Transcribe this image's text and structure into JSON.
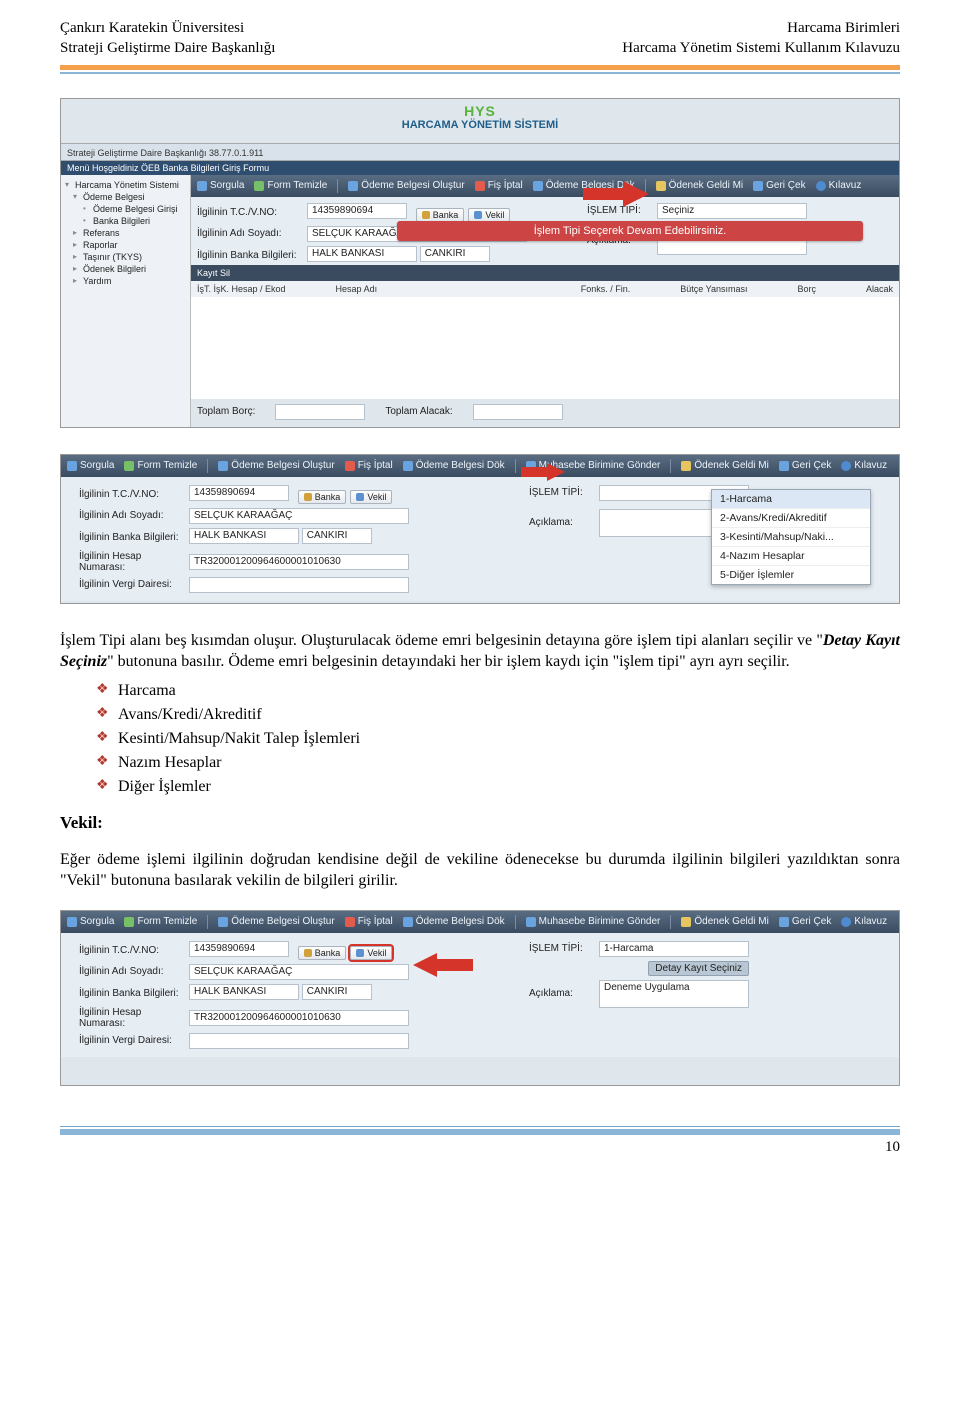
{
  "header": {
    "left_line1": "Çankırı Karatekin Üniversitesi",
    "left_line2": "Strateji Geliştirme Daire Başkanlığı",
    "right_line1": "Harcama Birimleri",
    "right_line2": "Harcama Yönetim Sistemi Kullanım Kılavuzu"
  },
  "shot_common": {
    "app_logo_tag": "HYS",
    "app_logo_sub": "HARCAMA YÖNETİM SİSTEMİ",
    "toolbar": {
      "sorgula": "Sorgula",
      "form_temizle": "Form Temizle",
      "odeme_olustur": "Ödeme Belgesi Oluştur",
      "fis_iptal": "Fiş İptal",
      "odeme_dok": "Ödeme Belgesi Dök",
      "muhasebe_gonder": "Muhasebe Birimine Gönder",
      "odenek_geldi": "Ödenek Geldi Mi",
      "geri_cek": "Geri Çek",
      "kilavuz": "Kılavuz"
    },
    "labels": {
      "tcvno": "İlgilinin T.C./V.NO:",
      "adsoyad": "İlgilinin Adı Soyadı:",
      "banka": "İlgilinin Banka Bilgileri:",
      "hesap": "İlgilinin Hesap Numarası:",
      "vergi": "İlgilinin Vergi Dairesi:",
      "islemtipi": "İŞLEM TİPİ:",
      "aciklama": "Açıklama:"
    },
    "buttons": {
      "banka": "Banka",
      "vekil": "Vekil"
    },
    "values": {
      "tcvno": "14359890694",
      "adsoyad": "SELÇUK KARAAĞAÇ",
      "banka": "HALK BANKASI",
      "banka_sube": "CANKIRI",
      "hesap": "TR320001200964600001010630",
      "vergi": ""
    }
  },
  "shot1": {
    "crumb": "Strateji Geliştirme Daire Başkanlığı 38.77.0.1.911",
    "menu_row": "Menü   Hoşgeldiniz   ÖEB   Banka Bilgileri Giriş Formu",
    "sidebar": {
      "root": "Harcama Yönetim Sistemi",
      "n1": "Ödeme Belgesi",
      "n1a": "Ödeme Belgesi Girişi",
      "n1b": "Banka Bilgileri",
      "n2": "Referans",
      "n3": "Raporlar",
      "n4": "Taşınır (TKYS)",
      "n5": "Ödenek Bilgileri",
      "n6": "Yardım"
    },
    "islemtipi_placeholder": "Seçiniz",
    "banner": "İşlem Tipi Seçerek Devam Edebilirsiniz.",
    "grid_header": "Kayıt Sil",
    "grid_cols": {
      "c1": "İşT. İşK. Hesap / Ekod",
      "c2": "Hesap Adı",
      "c3": "Fonks. / Fin.",
      "c4": "Bütçe Yansıması",
      "c5": "Borç",
      "c6": "Alacak"
    },
    "totals": {
      "borc": "Toplam Borç:",
      "alacak": "Toplam Alacak:"
    }
  },
  "shot2": {
    "dropdown": {
      "o1": "1-Harcama",
      "o2": "2-Avans/Kredi/Akreditif",
      "o3": "3-Kesinti/Mahsup/Naki...",
      "o4": "4-Nazım Hesaplar",
      "o5": "5-Diğer İşlemler"
    }
  },
  "shot3": {
    "islemtipi_value": "1-Harcama",
    "detay_badge": "Detay Kayıt Seçiniz",
    "aciklama_value": "Deneme Uygulama"
  },
  "body": {
    "p1a": "İşlem Tipi alanı beş kısımdan oluşur. Oluşturulacak ödeme emri belgesinin detayına göre işlem tipi alanları seçilir ve \"",
    "p1b": "Detay Kayıt Seçiniz",
    "p1c": "\" butonuna basılır. Ödeme emri belgesinin detayındaki her bir işlem kaydı için \"işlem tipi\" ayrı ayrı seçilir.",
    "li1": "Harcama",
    "li2": "Avans/Kredi/Akreditif",
    "li3": "Kesinti/Mahsup/Nakit Talep İşlemleri",
    "li4": "Nazım Hesaplar",
    "li5": "Diğer İşlemler",
    "h_vekil": "Vekil:",
    "p2": "Eğer ödeme işlemi ilgilinin doğrudan kendisine değil de vekiline ödenecekse bu durumda ilgilinin bilgileri yazıldıktan sonra \"Vekil\" butonuna basılarak vekilin de bilgileri girilir."
  },
  "page_number": "10"
}
